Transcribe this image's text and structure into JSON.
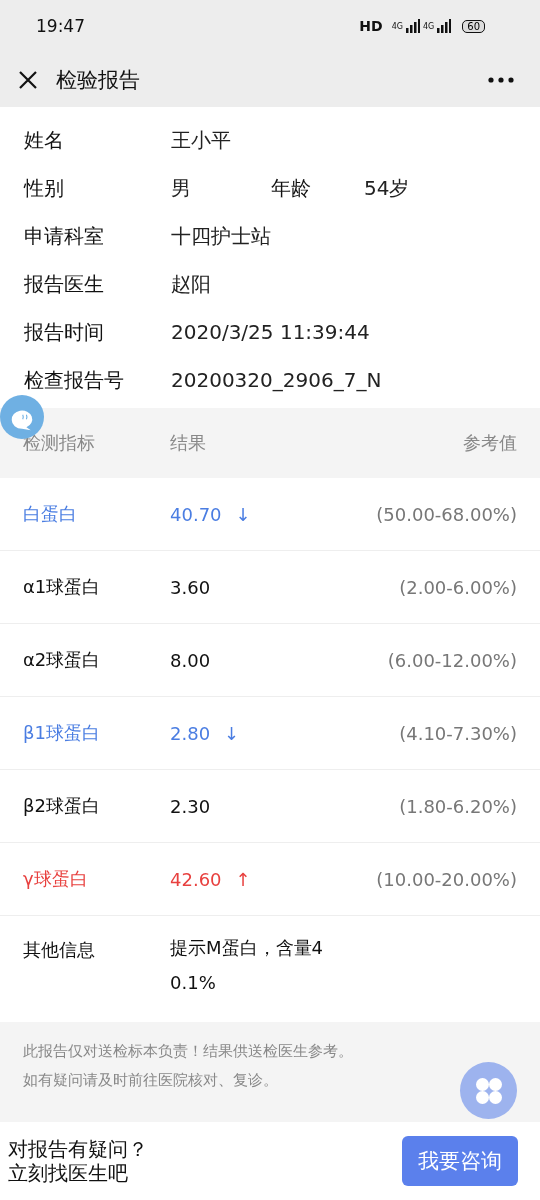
{
  "status_bar": {
    "time": "19:47",
    "hd": "HD",
    "sim_1": "4G",
    "sim_2": "4G",
    "battery": "60"
  },
  "nav": {
    "title": "检验报告"
  },
  "patient": [
    {
      "label": "姓名",
      "value": "王小平"
    },
    {
      "label": "性别",
      "value": "男",
      "extra_label": "年龄",
      "extra_value": "54岁"
    },
    {
      "label": "申请科室",
      "value": "十四护士站"
    },
    {
      "label": "报告医生",
      "value": "赵阳"
    },
    {
      "label": "报告时间",
      "value": "2020/3/25 11:39:44"
    },
    {
      "label": "检查报告号",
      "value": "20200320_2906_7_N"
    }
  ],
  "table": {
    "columns": [
      "检测指标",
      "结果",
      "参考值"
    ],
    "rows": [
      {
        "name": "白蛋白",
        "result": "40.70",
        "arrow": "↓",
        "color": "#4a7de2",
        "reference": "(50.00-68.00%)"
      },
      {
        "name": "α1球蛋白",
        "result": "3.60",
        "color": "#111111",
        "reference": "(2.00-6.00%)"
      },
      {
        "name": "α2球蛋白",
        "result": "8.00",
        "color": "#111111",
        "reference": "(6.00-12.00%)"
      },
      {
        "name": "β1球蛋白",
        "result": "2.80",
        "arrow": "↓",
        "color": "#4a7de2",
        "reference": "(4.10-7.30%)"
      },
      {
        "name": "β2球蛋白",
        "result": "2.30",
        "color": "#111111",
        "reference": "(1.80-6.20%)"
      },
      {
        "name": "γ球蛋白",
        "result": "42.60",
        "arrow": "↑",
        "color": "#e8413f",
        "reference": "(10.00-20.00%)"
      }
    ],
    "other": {
      "label": "其他信息",
      "value": "提示M蛋白，含量40.1%"
    }
  },
  "notice": [
    "此报告仅对送检标本负责！结果供送检医生参考。",
    "如有疑问请及时前往医院核对、复诊。"
  ],
  "bottom_bar": {
    "prompt": [
      "对报告有疑问？",
      "立刻找医生吧"
    ],
    "button": "我要咨询"
  }
}
